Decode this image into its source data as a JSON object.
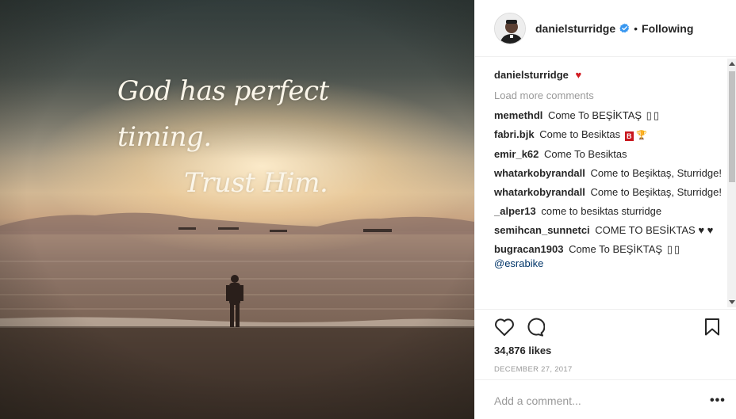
{
  "post": {
    "quote_line1": "God has perfect timing.",
    "quote_line2": "Trust Him."
  },
  "header": {
    "username": "danielsturridge",
    "separator": "•",
    "follow_state": "Following"
  },
  "caption": {
    "username": "danielsturridge",
    "emoji": "♥"
  },
  "load_more": "Load more comments",
  "comments": [
    {
      "user": "memethdl",
      "text": "Come To BEŞİKTAŞ",
      "extra": "▯▯"
    },
    {
      "user": "fabri.bjk",
      "text": "Come to Besiktas",
      "badge": "B",
      "trophy": "🏆"
    },
    {
      "user": "emir_k62",
      "text": "Come To Besiktas"
    },
    {
      "user": "whatarkobyrandall",
      "text": "Come to Beşiktaş, Sturridge!"
    },
    {
      "user": "whatarkobyrandall",
      "text": "Come to Beşiktaş, Sturridge!"
    },
    {
      "user": "_alper13",
      "text": "come to besiktas sturridge"
    },
    {
      "user": "semihcan_sunnetci",
      "text": "COME TO BESİKTAS ♥ ♥"
    },
    {
      "user": "bugracan1903",
      "text": "Come To BEŞİKTAŞ",
      "extra": "▯▯",
      "mention": "@esrabike"
    }
  ],
  "likes": "34,876 likes",
  "date": "DECEMBER 27, 2017",
  "add_comment": {
    "placeholder": "Add a comment..."
  },
  "more_options": "•••",
  "icons": [
    "heart-icon",
    "comment-icon",
    "bookmark-icon",
    "verified-badge-icon"
  ],
  "colors": {
    "verified": "#3897f0",
    "heart": "#d21c23",
    "muted": "#999999"
  }
}
